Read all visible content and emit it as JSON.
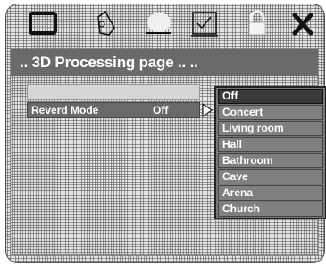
{
  "header": {
    "title": ".. 3D Processing page .. .."
  },
  "icons": [
    "tv-icon",
    "speaker-icon",
    "disc-icon",
    "checklist-icon",
    "lock-icon",
    "close-icon"
  ],
  "menu": {
    "rows": [
      {
        "label": "",
        "value": ""
      },
      {
        "label": "Reverd Mode",
        "value": "Off"
      }
    ]
  },
  "dropdown": {
    "options": [
      "Off",
      "Concert",
      "Living room",
      "Hall",
      "Bathroom",
      "Cave",
      "Arena",
      "Church"
    ],
    "selected": "Off"
  }
}
